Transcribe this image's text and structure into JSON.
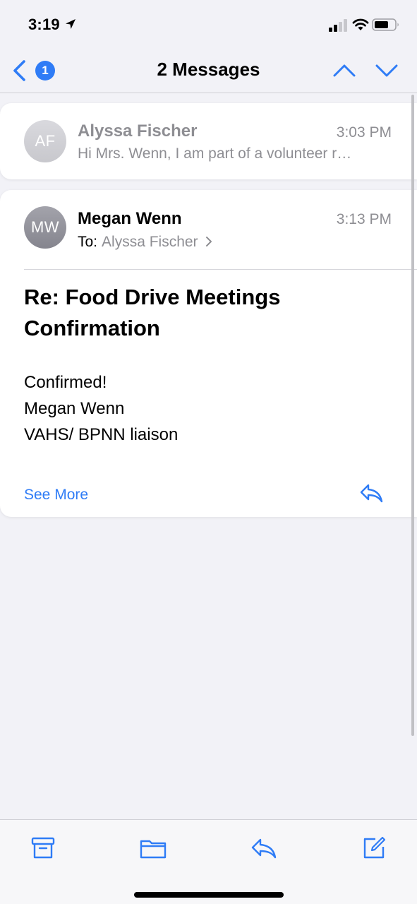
{
  "status_bar": {
    "time": "3:19"
  },
  "nav": {
    "back_badge": "1",
    "title": "2 Messages"
  },
  "messages": [
    {
      "initials": "AF",
      "sender": "Alyssa Fischer",
      "time": "3:03 PM",
      "preview": "Hi Mrs. Wenn, I am part of a volunteer r…"
    },
    {
      "initials": "MW",
      "sender": "Megan Wenn",
      "time": "3:13 PM",
      "to_label": "To:",
      "to_name": "Alyssa Fischer",
      "subject": "Re: Food Drive Meetings Confirmation",
      "body": [
        "Confirmed!",
        "Megan Wenn",
        "VAHS/ BPNN liaison"
      ],
      "see_more": "See More"
    }
  ],
  "colors": {
    "accent": "#2f7cf6",
    "secondary_text": "#8e8e93"
  },
  "icons": {
    "status": [
      "location-arrow-icon",
      "cellular-signal-icon",
      "wifi-icon",
      "battery-icon"
    ],
    "nav": [
      "back-chevron-icon",
      "chevron-up-icon",
      "chevron-down-icon"
    ],
    "toolbar": [
      "archive-icon",
      "folder-icon",
      "reply-icon",
      "compose-icon"
    ]
  }
}
